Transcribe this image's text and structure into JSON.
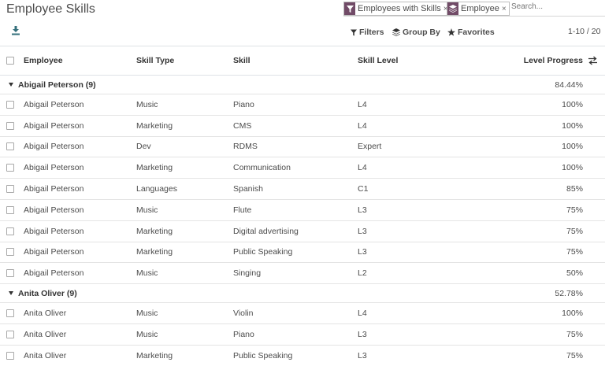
{
  "title": "Employee Skills",
  "search": {
    "facets": [
      {
        "label": "Employees with Skills",
        "icon": "filter-icon"
      },
      {
        "label": "Employee",
        "icon": "layers-icon"
      }
    ],
    "placeholder": "Search..."
  },
  "control_panel": {
    "filters_label": "Filters",
    "groupby_label": "Group By",
    "favorites_label": "Favorites",
    "pager": "1-10 / 20"
  },
  "columns": {
    "employee": "Employee",
    "skill_type": "Skill Type",
    "skill": "Skill",
    "skill_level": "Skill Level",
    "level_progress": "Level Progress"
  },
  "groups": [
    {
      "name": "Abigail Peterson (9)",
      "progress": "84.44%",
      "rows": [
        {
          "employee": "Abigail Peterson",
          "skill_type": "Music",
          "skill": "Piano",
          "level": "L4",
          "progress": "100%"
        },
        {
          "employee": "Abigail Peterson",
          "skill_type": "Marketing",
          "skill": "CMS",
          "level": "L4",
          "progress": "100%"
        },
        {
          "employee": "Abigail Peterson",
          "skill_type": "Dev",
          "skill": "RDMS",
          "level": "Expert",
          "progress": "100%"
        },
        {
          "employee": "Abigail Peterson",
          "skill_type": "Marketing",
          "skill": "Communication",
          "level": "L4",
          "progress": "100%"
        },
        {
          "employee": "Abigail Peterson",
          "skill_type": "Languages",
          "skill": "Spanish",
          "level": "C1",
          "progress": "85%"
        },
        {
          "employee": "Abigail Peterson",
          "skill_type": "Music",
          "skill": "Flute",
          "level": "L3",
          "progress": "75%"
        },
        {
          "employee": "Abigail Peterson",
          "skill_type": "Marketing",
          "skill": "Digital advertising",
          "level": "L3",
          "progress": "75%"
        },
        {
          "employee": "Abigail Peterson",
          "skill_type": "Marketing",
          "skill": "Public Speaking",
          "level": "L3",
          "progress": "75%"
        },
        {
          "employee": "Abigail Peterson",
          "skill_type": "Music",
          "skill": "Singing",
          "level": "L2",
          "progress": "50%"
        }
      ]
    },
    {
      "name": "Anita Oliver (9)",
      "progress": "52.78%",
      "rows": [
        {
          "employee": "Anita Oliver",
          "skill_type": "Music",
          "skill": "Violin",
          "level": "L4",
          "progress": "100%"
        },
        {
          "employee": "Anita Oliver",
          "skill_type": "Music",
          "skill": "Piano",
          "level": "L3",
          "progress": "75%"
        },
        {
          "employee": "Anita Oliver",
          "skill_type": "Marketing",
          "skill": "Public Speaking",
          "level": "L3",
          "progress": "75%"
        }
      ]
    }
  ],
  "colors": {
    "accent": "#714b67",
    "download": "#35707c"
  }
}
